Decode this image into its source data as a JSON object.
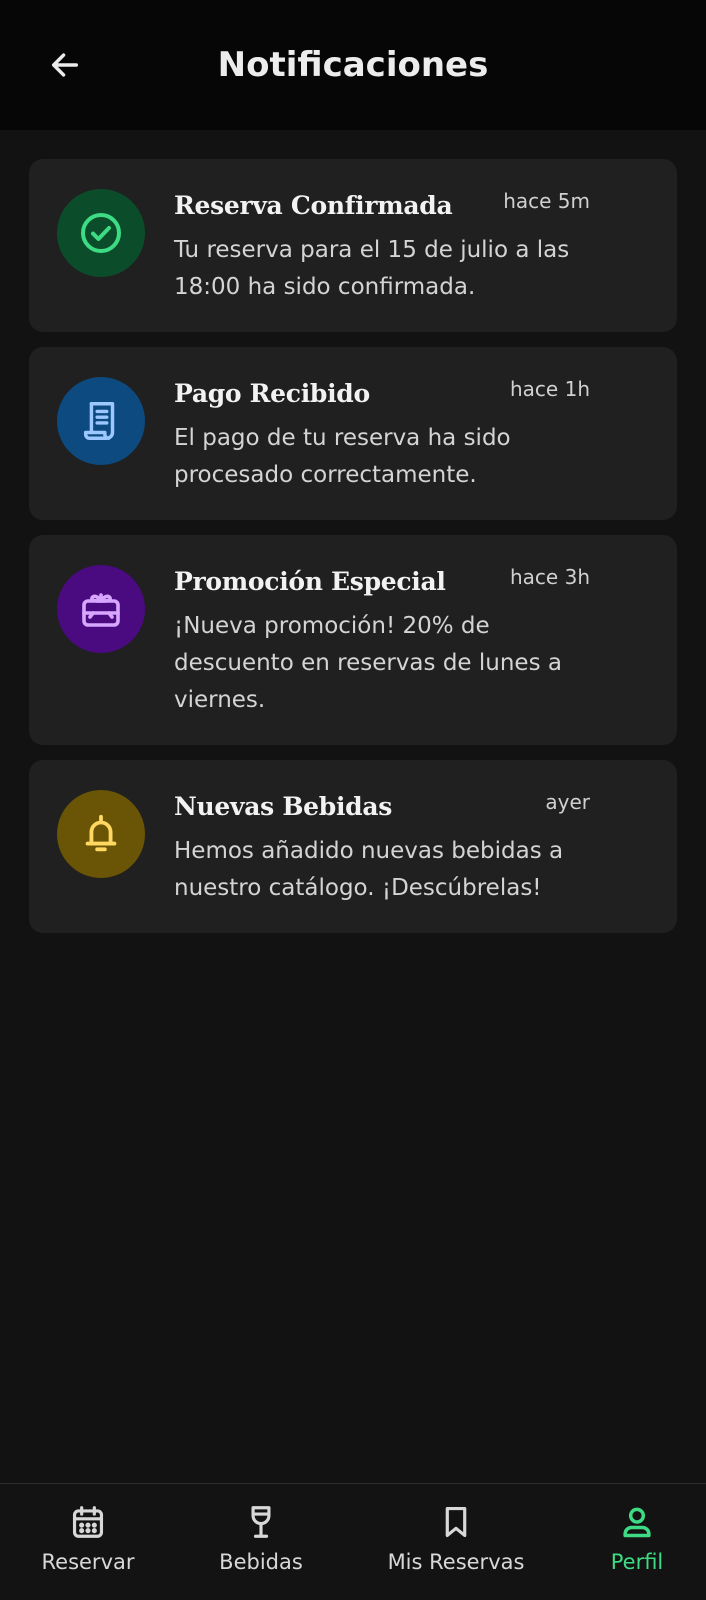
{
  "header": {
    "title": "Notificaciones",
    "back_icon": "arrow-left-icon"
  },
  "notifications": [
    {
      "title": "Reserva Confirmada",
      "time": "hace 5m",
      "body": "Tu reserva para el 15 de julio a las 18:00 ha sido confirmada.",
      "icon": "check-circle-icon",
      "icon_bg": "#0b4d2a",
      "icon_color": "#3ddc84"
    },
    {
      "title": "Pago Recibido",
      "time": "hace 1h",
      "body": "El pago de tu reserva ha sido procesado correctamente.",
      "icon": "receipt-icon",
      "icon_bg": "#0c4a80",
      "icon_color": "#9cc8ff"
    },
    {
      "title": "Promoción Especial",
      "time": "hace 3h",
      "body": "¡Nueva promoción! 20% de descuento en reservas de lunes a viernes.",
      "icon": "gift-icon",
      "icon_bg": "#4a0a80",
      "icon_color": "#d7a6ff"
    },
    {
      "title": "Nuevas Bebidas",
      "time": "ayer",
      "body": "Hemos añadido nuevas bebidas a nuestro catálogo. ¡Descúbrelas!",
      "icon": "bell-icon",
      "icon_bg": "#6a5405",
      "icon_color": "#ffd862"
    }
  ],
  "bottom_nav": {
    "items": [
      {
        "label": "Reservar",
        "icon": "calendar-icon",
        "active": false
      },
      {
        "label": "Bebidas",
        "icon": "wine-glass-icon",
        "active": false
      },
      {
        "label": "Mis Reservas",
        "icon": "bookmark-icon",
        "active": false
      },
      {
        "label": "Perfil",
        "icon": "person-icon",
        "active": true
      }
    ],
    "active_color": "#3ddc84",
    "inactive_color": "#d8d8d8"
  }
}
